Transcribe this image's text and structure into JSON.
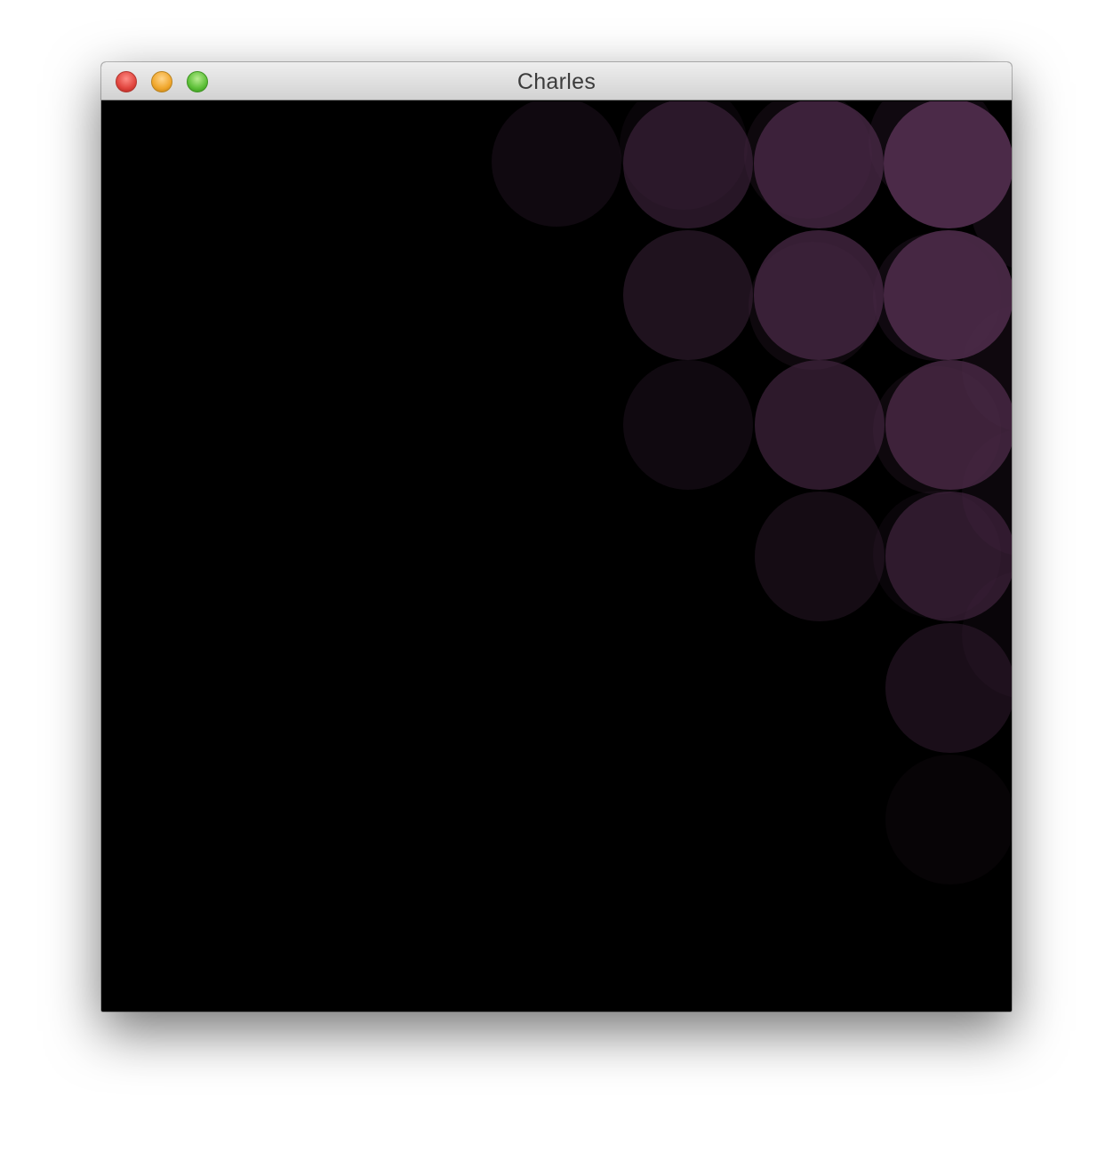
{
  "window": {
    "title": "Charles",
    "buttons": {
      "close": "close-icon",
      "minimize": "minimize-icon",
      "zoom": "zoom-icon"
    }
  },
  "canvas": {
    "background": "#000000",
    "circle_color": "#4b2a48"
  }
}
